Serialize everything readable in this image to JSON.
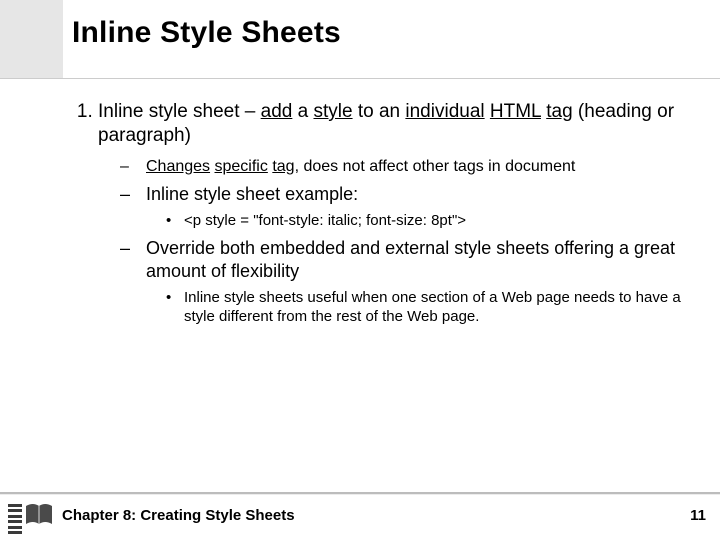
{
  "title": "Inline Style Sheets",
  "list": {
    "item1": {
      "num": "1.",
      "parts": {
        "a": "Inline style sheet – ",
        "b": "add",
        "c": " a ",
        "d": "style",
        "e": " to an ",
        "f": "individual",
        "g": " ",
        "h": "HTML",
        "i": " ",
        "j": "tag",
        "k": " (heading or paragraph)"
      },
      "sub": {
        "s1": {
          "a": "Changes",
          "b": " ",
          "c": "specific",
          "d": " ",
          "e": "tag",
          "f": ", does not affect other tags in document"
        },
        "s2": {
          "a": "Inline style sheet example:",
          "bullet1": "<p style = \"font-style: italic; font-size: 8pt\">"
        },
        "s3": {
          "a": "Override both embedded and external style sheets offering a great amount of flexibility",
          "bullet1": "Inline style sheets useful when one section of a Web page needs to have a style different from the rest of the Web page."
        }
      }
    }
  },
  "footer": {
    "chapter": "Chapter 8: Creating Style Sheets",
    "page": "11"
  }
}
